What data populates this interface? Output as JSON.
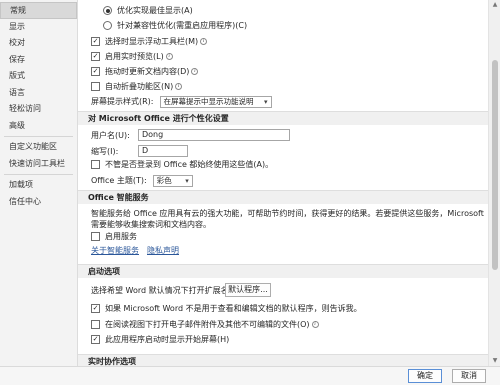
{
  "sidebar": {
    "items": [
      {
        "label": "常规"
      },
      {
        "label": "显示"
      },
      {
        "label": "校对"
      },
      {
        "label": "保存"
      },
      {
        "label": "版式"
      },
      {
        "label": "语言"
      },
      {
        "label": "轻松访问"
      },
      {
        "label": "高级"
      },
      {
        "label": "自定义功能区"
      },
      {
        "label": "快速访问工具栏"
      },
      {
        "label": "加载项"
      },
      {
        "label": "信任中心"
      }
    ]
  },
  "ui_options": {
    "radio_best_display": "优化实现最佳显示(A)",
    "radio_compat": "针对兼容性优化(需重启应用程序)(C)",
    "mini_toolbar": "选择时显示浮动工具栏(M)",
    "live_preview": "启用实时预览(L)",
    "update_while_drag": "拖动时更新文档内容(D)",
    "collapse_ribbon": "自动折叠功能区(N)",
    "screentip_label": "屏幕提示样式(R):",
    "screentip_value": "在屏幕提示中显示功能说明"
  },
  "personalize": {
    "header": "对 Microsoft Office 进行个性化设置",
    "username_label": "用户名(U):",
    "username_value": "Dong",
    "initials_label": "缩写(I):",
    "initials_value": "D",
    "always_use": "不管是否登录到 Office 都始终使用这些值(A)。",
    "theme_label": "Office 主题(T):",
    "theme_value": "彩色"
  },
  "intelligent": {
    "header": "Office 智能服务",
    "description": "智能服务给 Office 应用具有云的强大功能，可帮助节约时间，获得更好的结果。若要提供这些服务，Microsoft 需要能够收集搜索词和文档内容。",
    "enable": "启用服务",
    "about_link": "关于智能服务",
    "privacy_link": "隐私声明"
  },
  "startup": {
    "header": "启动选项",
    "default_programs_label": "选择希望 Word 默认情况下打开扩展名:",
    "default_programs_button": "默认程序...",
    "tell_me_default": "如果 Microsoft Word 不是用于查看和编辑文档的默认程序，则告诉我。",
    "open_reading": "在阅读视图下打开电子邮件附件及其他不可编辑的文件(O)",
    "show_start_screen": "此应用程序启动时显示开始屏幕(H)"
  },
  "collab": {
    "header": "实时协作选项"
  },
  "footer": {
    "ok_label": "确定",
    "cancel_label": "取消"
  },
  "check_mark": "✓",
  "info_glyph": "i",
  "icons": {
    "scroll_up": "▲",
    "scroll_down": "▼"
  }
}
